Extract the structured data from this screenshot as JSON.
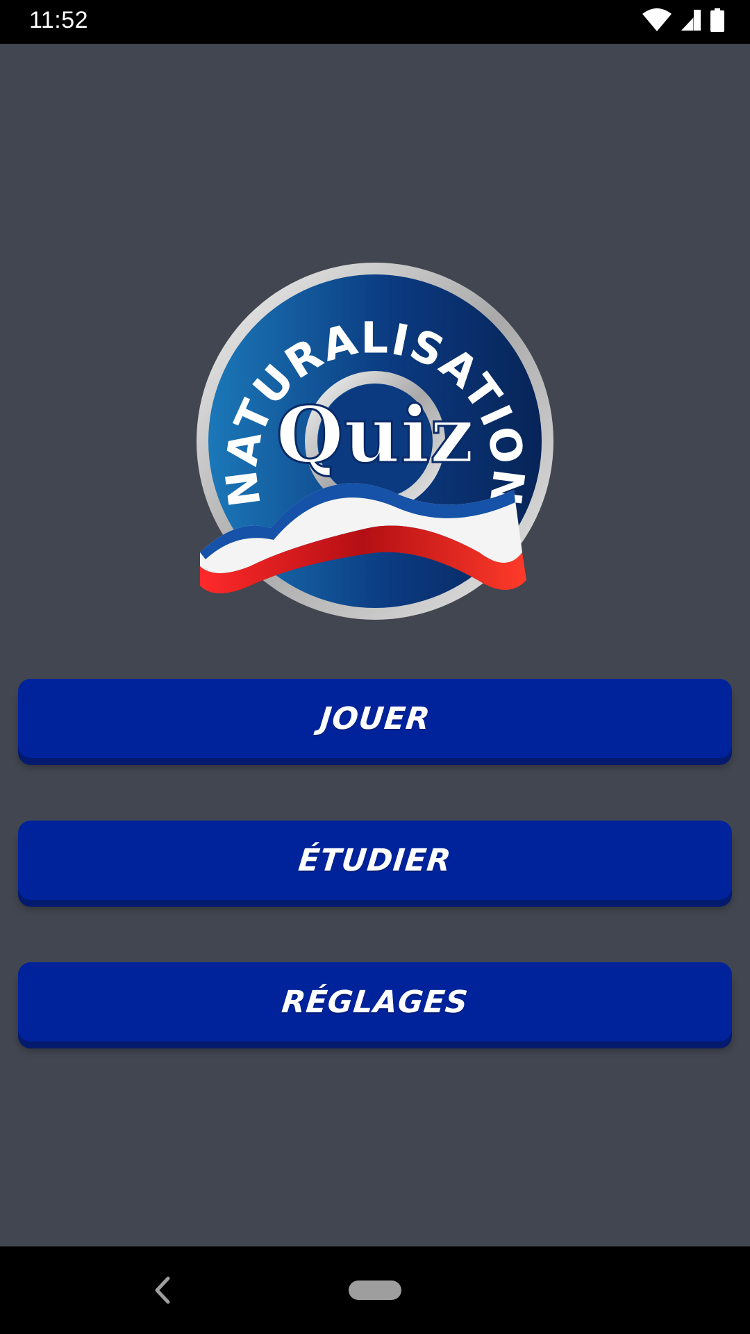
{
  "status_bar": {
    "time": "11:52",
    "icons": [
      "wifi-icon",
      "cell-signal-icon",
      "battery-icon"
    ]
  },
  "logo": {
    "arc_text": "NATURALISATION",
    "center_text": "Quiz",
    "colors": {
      "disc_dark": "#0a2a68",
      "disc_light": "#1a6db0",
      "ribbon_blue": "#1552a8",
      "ribbon_white": "#f4f4f4",
      "ribbon_red": "#e0141a"
    }
  },
  "menu": {
    "play_label": "JOUER",
    "study_label": "ÉTUDIER",
    "settings_label": "RÉGLAGES"
  },
  "nav_bar": {
    "icons": [
      "back-icon",
      "home-pill-icon"
    ]
  },
  "colors": {
    "background": "#424650",
    "button": "#00239c",
    "button_shadow": "#041a6e"
  }
}
